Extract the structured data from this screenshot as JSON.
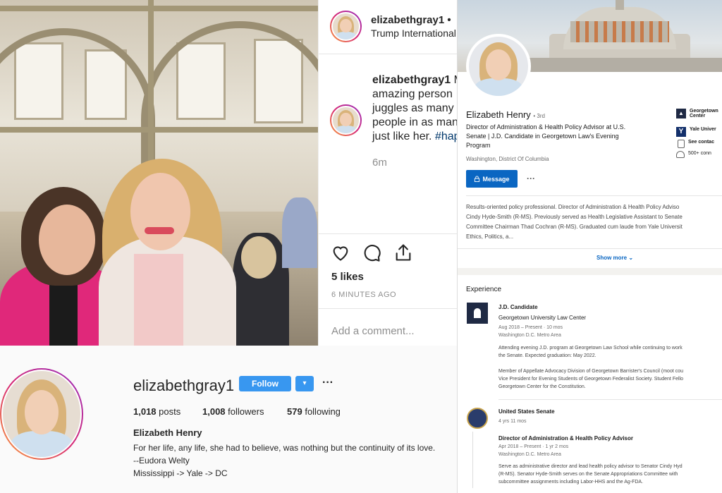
{
  "post": {
    "username": "elizabethgray1",
    "dot": "•",
    "location": "Trump International",
    "caption_username": "elizabethgray1",
    "caption_lines": [
      "M",
      "amazing person",
      "juggles as many",
      "people in as man",
      "just like her. "
    ],
    "caption_hashtag": "#hap",
    "caption_time": "6m",
    "likes": "5 likes",
    "timestamp": "6 MINUTES AGO",
    "comment_placeholder": "Add a comment..."
  },
  "profile": {
    "username": "elizabethgray1",
    "follow_label": "Follow",
    "dropdown_glyph": "▾",
    "more_glyph": "···",
    "posts_count": "1,018",
    "posts_label": "posts",
    "followers_count": "1,008",
    "followers_label": "followers",
    "following_count": "579",
    "following_label": "following",
    "full_name": "Elizabeth Henry",
    "bio": [
      "For her life, any life, she had to believe, was nothing but the continuity of its love.",
      "--Eudora Welty",
      "Mississippi -> Yale -> DC"
    ]
  },
  "linkedin": {
    "name": "Elizabeth Henry",
    "degree": "• 3rd",
    "headline": [
      "Director of Administration & Health Policy Advisor at U.S.",
      "Senate | J.D. Candidate in Georgetown Law's Evening",
      "Program"
    ],
    "location": "Washington, District Of Columbia",
    "message_label": "Message",
    "more_glyph": "···",
    "side_items": [
      {
        "icon": "georgetown-icon",
        "label": "Georgetown",
        "label2": "Center"
      },
      {
        "icon": "yale-icon",
        "label": "Yale Univer",
        "label2": ""
      },
      {
        "icon": "contact-icon",
        "label": "See contac",
        "label2": ""
      },
      {
        "icon": "connections-icon",
        "label": "500+ conn",
        "label2": ""
      }
    ],
    "summary": [
      "Results-oriented policy professional. Director of Administration & Health Policy Adviso",
      "Cindy Hyde-Smith (R-MS). Previously served as Health Legislative Assistant to Senate",
      "Committee Chairman Thad Cochran (R-MS). Graduated cum laude from Yale Universit",
      "Ethics, Politics, a..."
    ],
    "show_more": "Show more",
    "experience_heading": "Experience",
    "experience": [
      {
        "title": "J.D. Candidate",
        "org": "Georgetown University Law Center",
        "dates": "Aug 2018 – Present · 10 mos",
        "place": "Washington D.C. Metro Area",
        "desc": [
          "Attending evening J.D. program at Georgetown Law School while continuing to work",
          "the Senate. Expected graduation: May 2022.",
          "",
          "Member of Appellate Advocacy Division of Georgetown Barrister's Council (moot cou",
          "Vice President for Evening Students of Georgetown Federalist Society. Student Fello",
          "Georgetown Center for the Constitution."
        ]
      },
      {
        "org": "United States Senate",
        "tenure": "4 yrs 11 mos",
        "title": "Director of Administration & Health Policy Advisor",
        "dates": "Apr 2018 – Present · 1 yr 2 mos",
        "place": "Washington D.C. Metro Area",
        "desc": [
          "Serve as administrative director and lead health policy advisor to Senator Cindy Hyd",
          "(R-MS). Senator Hyde-Smith serves on the Senate Appropriations Committee with",
          "subcommittee assignments including Labor-HHS and the Ag-FDA."
        ]
      }
    ]
  },
  "colors": {
    "ig_blue": "#3897f0",
    "li_blue": "#0a66c2",
    "ring_gradient": [
      "#f9a13b",
      "#d62976",
      "#962fbf"
    ]
  }
}
